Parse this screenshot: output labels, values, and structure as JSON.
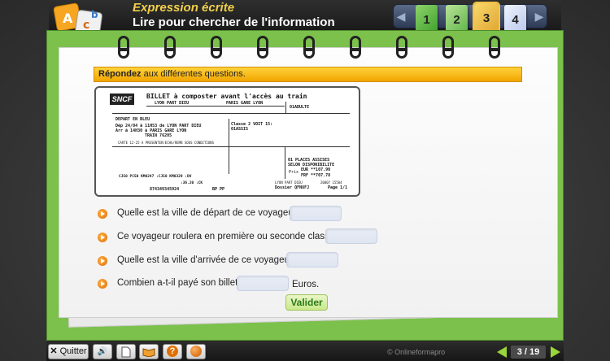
{
  "header": {
    "subtitle": "Expression écrite",
    "title": "Lire pour chercher de l'information",
    "logo_letters": [
      "A",
      "c",
      "b"
    ],
    "pages": [
      "1",
      "2",
      "3",
      "4"
    ],
    "active_page": "3"
  },
  "instruction": {
    "bold": "Répondez",
    "rest": " aux différentes questions."
  },
  "ticket": {
    "logo": "SNCF",
    "heading": "BILLET à composter avant l'accès au train",
    "from_header": "LYON PART DIEU",
    "to_header": "PARIS GARE LYON",
    "passenger": "01ADULTE",
    "depart_label": "DEPART EN BLEU",
    "line1": "Dép 24/04 à 11H53 de LYON PART DIEU",
    "line2": "Arr        à 14H30 à PARIS GARE LYON",
    "line3": "TRAIN        76205",
    "conditions": "CARTE 12-25 A PRESENTER/ECHG/REMB SOUS CONDITIONS",
    "classe": "Classe  2   VOIT 15:",
    "seat": "01ASSIS",
    "places": "01 PLACES ASSISES",
    "selon": "SELON DISPONIBILITE",
    "prix_label": "Prix",
    "eur": "EUR     **107.90",
    "frf": "FRF     **707.78",
    "codes1": "CJ50   PC50 KM0247        :CJ50         KM0329       :DV",
    "codes2": ":36.20                                :CK",
    "number": "874349345924",
    "bp": "BP  PP",
    "station": "LYON PART DIEU",
    "dossier": "Dossier   QFNUFJ",
    "page": "Page   1/1",
    "num_small": "20007     15504"
  },
  "questions": [
    {
      "text": "Quelle est la ville de départ de ce voyageur ?"
    },
    {
      "text": "Ce voyageur roulera en première ou seconde classe ?"
    },
    {
      "text": "Quelle est la ville d'arrivée de ce voyageur ?"
    },
    {
      "text": "Combien a-t-il payé son billet ?"
    }
  ],
  "currency": "Euros.",
  "validate_label": "Valider",
  "footer": {
    "quit": "Quitter",
    "copyright": "© Onlineformapro",
    "counter": "3 / 19"
  }
}
